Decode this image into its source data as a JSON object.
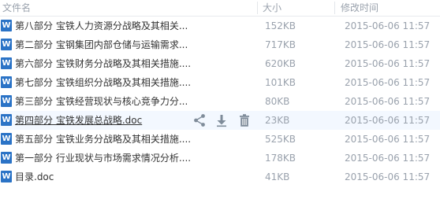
{
  "header": {
    "name": "文件名",
    "size": "大小",
    "date": "修改时间"
  },
  "icons": {
    "file_type": "word-doc-icon",
    "file_type_glyph": "W",
    "share": "share-icon",
    "download": "download-icon",
    "delete": "trash-icon"
  },
  "colors": {
    "doc_icon_bg": "#2b73c6",
    "row_hover_bg": "#f3f8ff",
    "muted_text": "#9aa2ad",
    "action_icon": "#7f8c9a"
  },
  "files": [
    {
      "name": "第八部分 宝铁人力资源分战略及其相关...",
      "size": "152KB",
      "date": "2015-06-06 11:57"
    },
    {
      "name": "第二部分 宝钢集团内部仓储与运输需求...",
      "size": "717KB",
      "date": "2015-06-06 11:57"
    },
    {
      "name": "第六部分 宝铁财务分战略及其相关措施....",
      "size": "620KB",
      "date": "2015-06-06 11:57"
    },
    {
      "name": "第七部分 宝铁组织分战略及其相关措施....",
      "size": "101KB",
      "date": "2015-06-06 11:57"
    },
    {
      "name": "第三部分 宝铁经营现状与核心竞争力分...",
      "size": "80KB",
      "date": "2015-06-06 11:57"
    },
    {
      "name": "第四部分 宝铁发展总战略.doc",
      "size": "23KB",
      "date": "2015-06-06 11:57"
    },
    {
      "name": "第五部分 宝铁业务分战略及其相关措施....",
      "size": "525KB",
      "date": "2015-06-06 11:57"
    },
    {
      "name": "第一部分 行业现状与市场需求情况分析....",
      "size": "178KB",
      "date": "2015-06-06 11:57"
    },
    {
      "name": "目录.doc",
      "size": "41KB",
      "date": "2015-06-06 11:57"
    }
  ],
  "hovered_row_index": 5
}
